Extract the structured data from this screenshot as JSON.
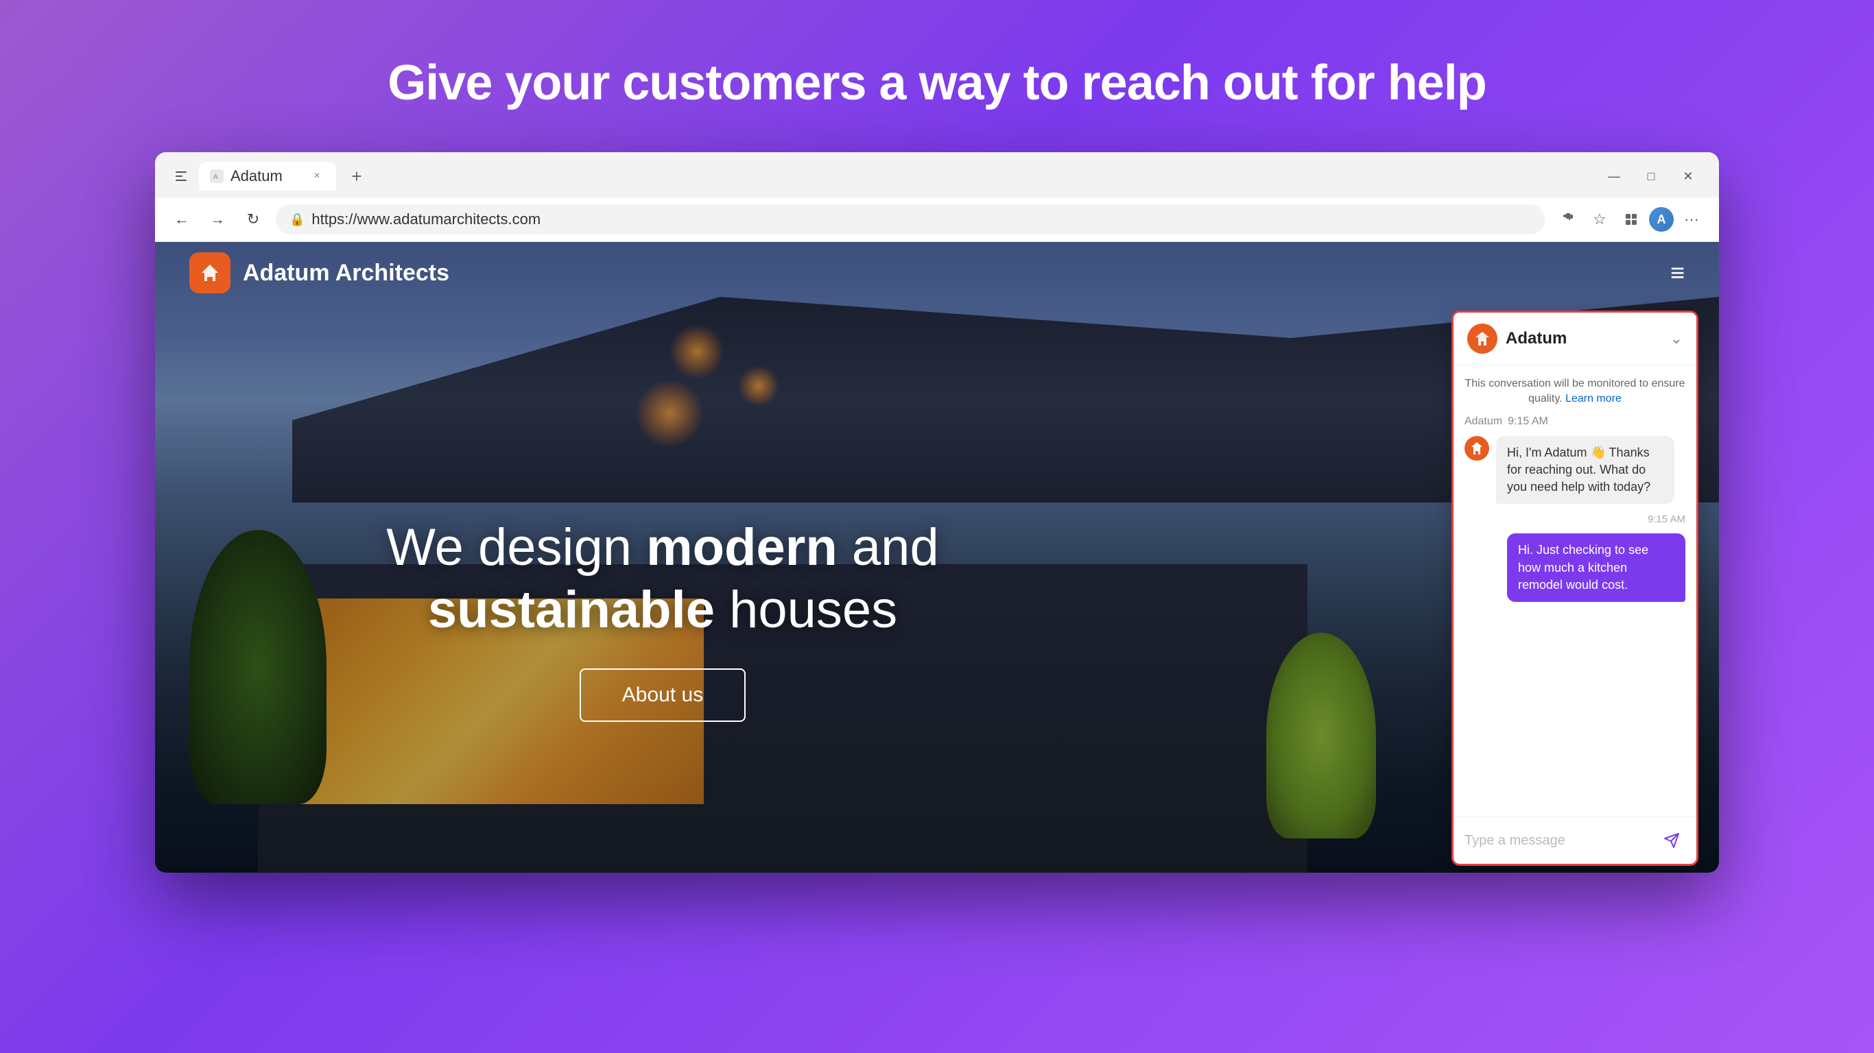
{
  "page": {
    "headline": "Give your customers a way to reach out for help"
  },
  "browser": {
    "tab_title": "Adatum",
    "url": "https://www.adatumarchitects.com",
    "new_tab_label": "+",
    "window_controls": {
      "minimize": "—",
      "maximize": "□",
      "close": "✕"
    }
  },
  "website": {
    "logo_text": "Adatum Architects",
    "hero_line1": "We design ",
    "hero_bold1": "modern",
    "hero_line2": " and",
    "hero_bold2": "sustainable",
    "hero_line3": " houses",
    "cta_button": "About us"
  },
  "chat": {
    "title": "Adatum",
    "monitor_notice": "This conversation will be monitored to ensure quality.",
    "learn_more": "Learn more",
    "sender": "Adatum",
    "sender_time": "9:15 AM",
    "bot_greeting": "Hi, I'm Adatum 👋 Thanks for reaching out. What do you need help with today?",
    "bot_time": "9:15 AM",
    "user_message": "Hi. Just checking to see how much a kitchen remodel would cost.",
    "input_placeholder": "Type a message"
  }
}
